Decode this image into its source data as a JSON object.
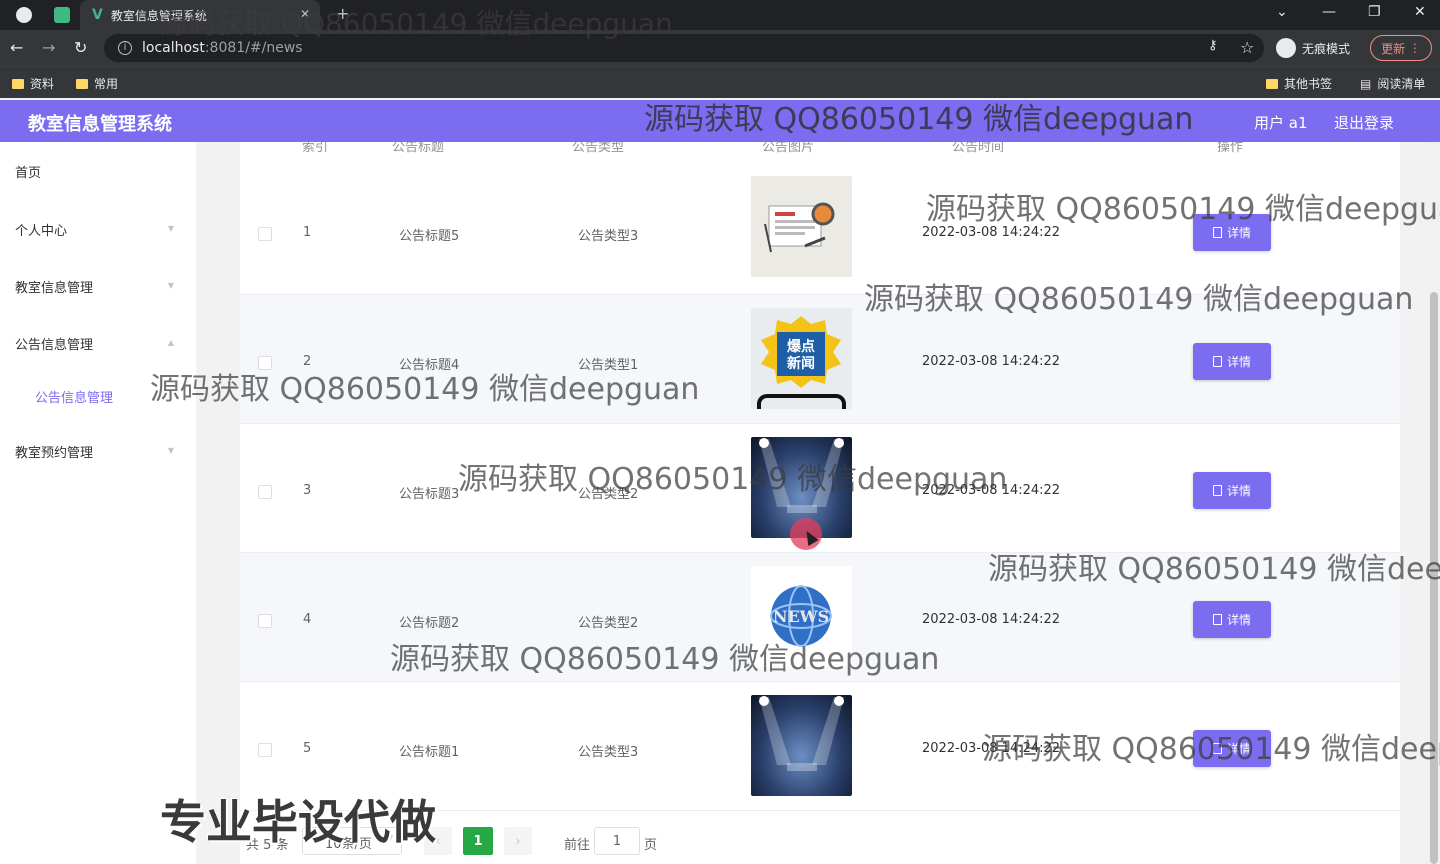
{
  "browser": {
    "tab_title": "教室信息管理系统",
    "tab_close": "✕",
    "new_tab": "+",
    "url_host": "localhost",
    "url_path": ":8081/#/news",
    "incognito_label": "无痕模式",
    "update_label": "更新",
    "bookmarks": [
      "资料",
      "常用"
    ],
    "bookmarks_right": [
      "其他书签",
      "阅读清单"
    ]
  },
  "header": {
    "title": "教室信息管理系统",
    "user": "用户 a1",
    "logout": "退出登录"
  },
  "sidebar": {
    "items": [
      "首页",
      "个人中心",
      "教室信息管理",
      "公告信息管理",
      "教室预约管理"
    ],
    "sub_active": "公告信息管理"
  },
  "table": {
    "headers": [
      "索引",
      "公告标题",
      "公告类型",
      "公告图片",
      "公告时间",
      "操作"
    ],
    "rows": [
      {
        "index": "1",
        "title": "公告标题5",
        "type": "公告类型3",
        "time": "2022-03-08 14:24:22",
        "action": "详情",
        "image": "news-paper"
      },
      {
        "index": "2",
        "title": "公告标题4",
        "type": "公告类型1",
        "time": "2022-03-08 14:24:22",
        "action": "详情",
        "image": "hot-news-phone"
      },
      {
        "index": "3",
        "title": "公告标题3",
        "type": "公告类型2",
        "time": "2022-03-08 14:24:22",
        "action": "详情",
        "image": "news-stage"
      },
      {
        "index": "4",
        "title": "公告标题2",
        "type": "公告类型2",
        "time": "2022-03-08 14:24:22",
        "action": "详情",
        "image": "news-globe"
      },
      {
        "index": "5",
        "title": "公告标题1",
        "type": "公告类型3",
        "time": "2022-03-08 14:24:22",
        "action": "详情",
        "image": "news-stage"
      }
    ]
  },
  "pagination": {
    "total": "共 5 条",
    "page_size": "10条/页",
    "current": "1",
    "goto_prefix": "前往",
    "goto_value": "1",
    "goto_suffix": "页"
  },
  "overlay": {
    "watermark": "源码获取 QQ86050149 微信deepguan",
    "banner": "专业毕设代做"
  },
  "colors": {
    "accent": "#7b6cf0",
    "pager_active": "#27a844"
  }
}
